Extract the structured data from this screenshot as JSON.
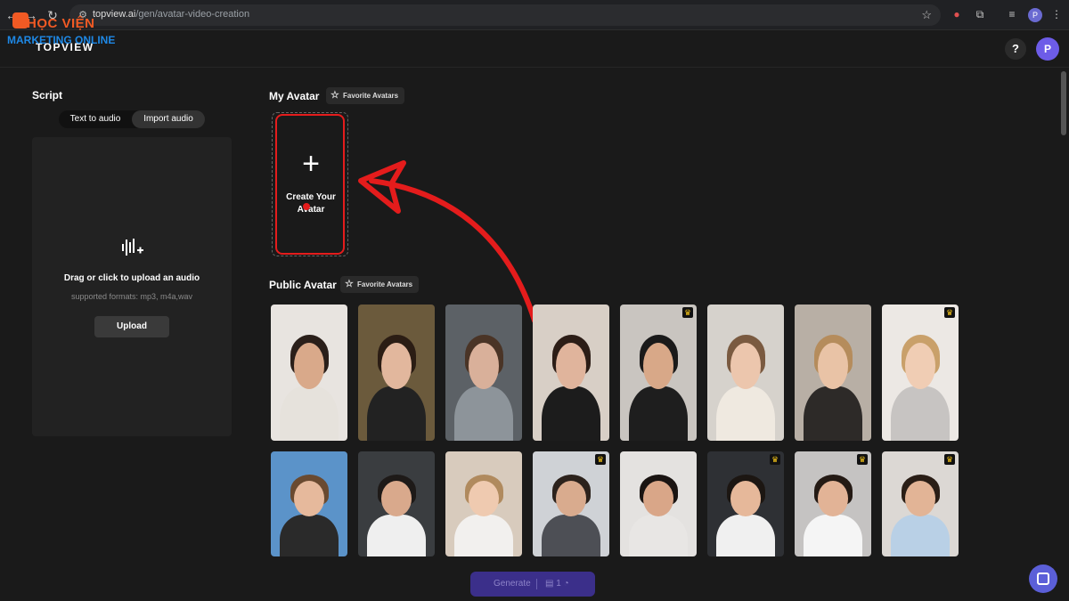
{
  "browser": {
    "url_host": "topview.ai",
    "url_path": "/gen/avatar-video-creation",
    "profile_initial": "P"
  },
  "watermark": {
    "line1": "HỌC VIỆN",
    "line2": "MARKETING ONLINE"
  },
  "header": {
    "logo": "TOPVIEW",
    "help": "?",
    "user_initial": "P"
  },
  "script": {
    "title": "Script",
    "tabs": [
      {
        "label": "Text to audio",
        "active": false
      },
      {
        "label": "Import audio",
        "active": true
      }
    ],
    "upload_prompt": "Drag or click to upload an audio",
    "formats": "supported formats: mp3, m4a,wav",
    "upload_button": "Upload"
  },
  "my_avatar": {
    "title": "My Avatar",
    "favorite_label": "Favorite Avatars",
    "create_label": "Create Your Avatar"
  },
  "public_avatar": {
    "title": "Public Avatar",
    "favorite_label": "Favorite Avatars",
    "rows": [
      [
        {
          "bg": "#e8e4e0",
          "skin": "#d9a98a",
          "hair": "#2a1f1a",
          "cloth": "#e6e2dc",
          "premium": false
        },
        {
          "bg": "#6b5a3c",
          "skin": "#e2b79d",
          "hair": "#2b1d14",
          "cloth": "#222222",
          "premium": false
        },
        {
          "bg": "#5c6166",
          "skin": "#d9b09a",
          "hair": "#4a3426",
          "cloth": "#8d949a",
          "premium": false
        },
        {
          "bg": "#d8cfc6",
          "skin": "#e0b49c",
          "hair": "#2c1d16",
          "cloth": "#1c1c1c",
          "premium": false
        },
        {
          "bg": "#c9c5c0",
          "skin": "#d8a888",
          "hair": "#1a1a1a",
          "cloth": "#1e1e1e",
          "premium": true
        },
        {
          "bg": "#d6d2cc",
          "skin": "#ecc6ad",
          "hair": "#7a5a40",
          "cloth": "#efe9e0",
          "premium": false
        },
        {
          "bg": "#b8afa5",
          "skin": "#e9c3a6",
          "hair": "#b58c5c",
          "cloth": "#2d2a28",
          "premium": false
        },
        {
          "bg": "#ece8e4",
          "skin": "#f0cdb4",
          "hair": "#c9a06a",
          "cloth": "#c7c4c2",
          "premium": true
        }
      ],
      [
        {
          "bg": "#5b93c9",
          "skin": "#e6b99c",
          "hair": "#6a4a30",
          "cloth": "#2a2a2a",
          "premium": false
        },
        {
          "bg": "#3a3d40",
          "skin": "#d9a98c",
          "hair": "#1e1a18",
          "cloth": "#efefef",
          "premium": false
        },
        {
          "bg": "#d8cbbd",
          "skin": "#efcab0",
          "hair": "#b08a5e",
          "cloth": "#f2f0ee",
          "premium": false
        },
        {
          "bg": "#cfd2d6",
          "skin": "#d9ab8e",
          "hair": "#2c221c",
          "cloth": "#4d4f55",
          "premium": true
        },
        {
          "bg": "#e4e2e0",
          "skin": "#d9a688",
          "hair": "#1a1412",
          "cloth": "#e8e6e4",
          "premium": false
        },
        {
          "bg": "#2e3034",
          "skin": "#e6b89a",
          "hair": "#1c1612",
          "cloth": "#f0f0f0",
          "premium": true
        },
        {
          "bg": "#c5c3c2",
          "skin": "#e2b396",
          "hair": "#241a14",
          "cloth": "#f5f5f5",
          "premium": true
        },
        {
          "bg": "#dcd8d4",
          "skin": "#e2b496",
          "hair": "#2a1e16",
          "cloth": "#b9d0e6",
          "premium": true
        }
      ]
    ]
  },
  "footer": {
    "generate_label": "Generate",
    "credit_count": "1"
  },
  "colors": {
    "accent": "#6d5ce8",
    "highlight_red": "#e41c1c",
    "crown": "#f5c518"
  }
}
